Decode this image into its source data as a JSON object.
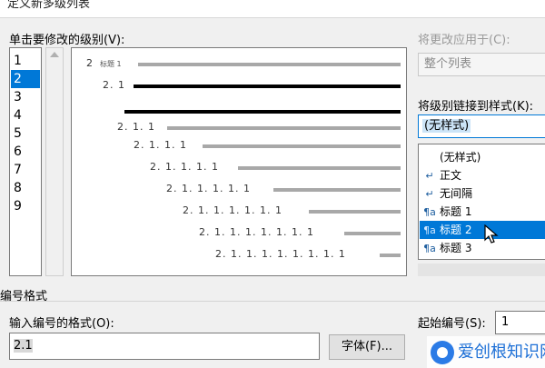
{
  "dialog": {
    "title": "定义新多级列表"
  },
  "level_section": {
    "label": "单击要修改的级别(V):",
    "levels": [
      "1",
      "2",
      "3",
      "4",
      "5",
      "6",
      "7",
      "8",
      "9"
    ],
    "selected": "2"
  },
  "preview": {
    "rows": [
      {
        "number": "2",
        "small_text": "标题 1",
        "heavy": false
      },
      {
        "number": "2. 1",
        "small_text": "",
        "heavy": true
      },
      {
        "number": "",
        "small_text": "",
        "heavy": true
      },
      {
        "number": "2. 1. 1",
        "small_text": "",
        "heavy": false
      },
      {
        "number": "2. 1. 1. 1",
        "small_text": "",
        "heavy": false
      },
      {
        "number": "2. 1. 1. 1. 1",
        "small_text": "",
        "heavy": false
      },
      {
        "number": "2. 1. 1. 1. 1. 1",
        "small_text": "",
        "heavy": false
      },
      {
        "number": "2. 1. 1. 1. 1. 1. 1",
        "small_text": "",
        "heavy": false
      },
      {
        "number": "2. 1. 1. 1. 1. 1. 1. 1",
        "small_text": "",
        "heavy": false
      },
      {
        "number": "2. 1. 1. 1. 1. 1. 1. 1. 1",
        "small_text": "",
        "heavy": false
      }
    ]
  },
  "apply_to": {
    "label": "将更改应用于(C):",
    "value": "整个列表"
  },
  "link_style": {
    "label": "将级别链接到样式(K):",
    "value": "(无样式)",
    "options": [
      {
        "label": "(无样式)",
        "icon": "none"
      },
      {
        "label": "正文",
        "icon": "paragraph-mark-icon"
      },
      {
        "label": "无间隔",
        "icon": "paragraph-mark-icon"
      },
      {
        "label": "标题 1",
        "icon": "linked-style-icon"
      },
      {
        "label": "标题 2",
        "icon": "linked-style-icon"
      },
      {
        "label": "标题 3",
        "icon": "linked-style-icon"
      }
    ],
    "selected": "标题 2"
  },
  "number_format": {
    "section_label": "编号格式",
    "input_label": "输入编号的格式(O):",
    "input_value": "2.1",
    "font_button": "字体(F)...",
    "start_label": "起始编号(S):",
    "start_value": "1"
  },
  "watermark": {
    "text": "爱创根知识网"
  },
  "colors": {
    "selection": "#0078d7",
    "dialog_bg": "#f0f0f0",
    "preview_line": "#a8a8a8"
  }
}
